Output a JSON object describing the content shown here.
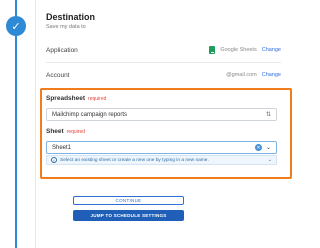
{
  "step": {
    "icon": "check-icon"
  },
  "destination": {
    "title": "Destination",
    "subtitle": "Save my data to"
  },
  "application": {
    "label": "Application",
    "value": "Google Sheets",
    "change": "Change",
    "icon": "google-sheets-icon"
  },
  "account": {
    "label": "Account",
    "value": "@gmail.com",
    "change": "Change"
  },
  "spreadsheet": {
    "label": "Spreadsheet",
    "required": "required",
    "value": "Mailchimp campaign reports"
  },
  "sheet": {
    "label": "Sheet",
    "required": "required",
    "value": "Sheet1",
    "hint": "Select an existing sheet or create a new one by typing in a new name."
  },
  "buttons": {
    "continue": "CONTINUE",
    "jump": "JUMP TO SCHEDULE SETTINGS"
  },
  "colors": {
    "accent": "#2f8ad6",
    "highlight": "#f07c1c",
    "primary_button": "#1f5fb8"
  }
}
